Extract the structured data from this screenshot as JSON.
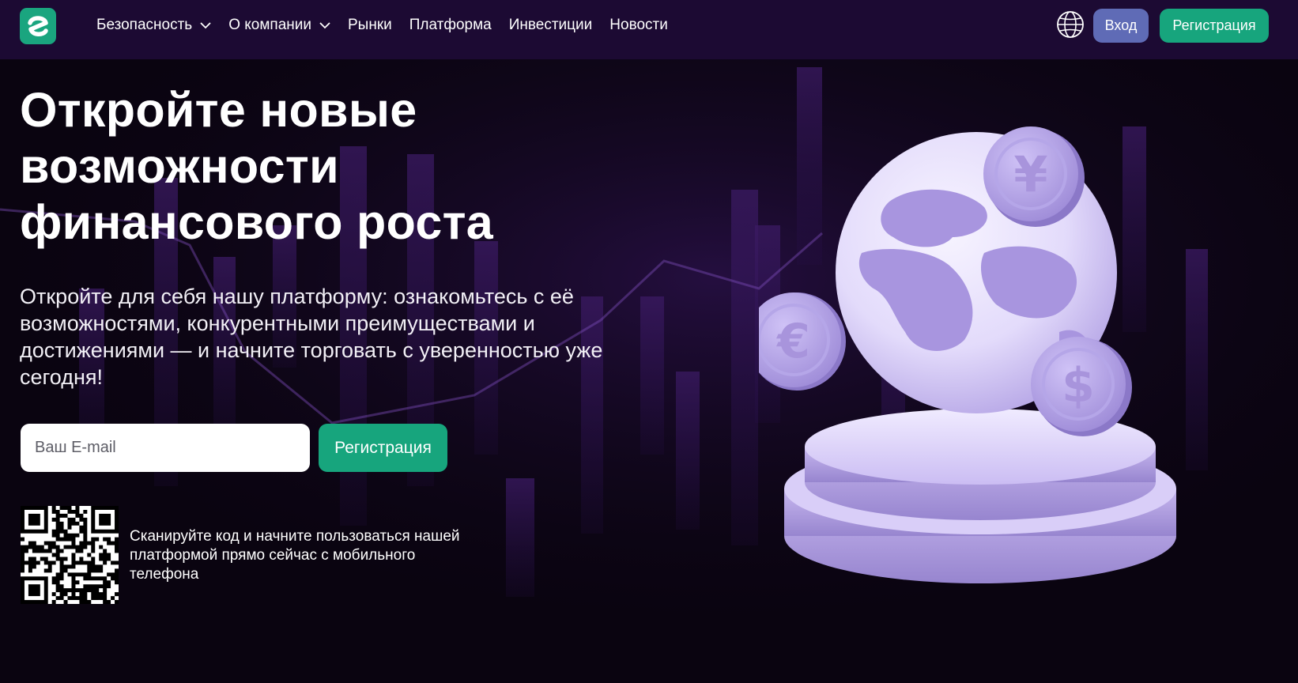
{
  "colors": {
    "nav_bg": "#1c0a33",
    "hero_bg": "#0a0410",
    "accent_green": "#17a57d",
    "login_blue": "#5f6bb6",
    "illustration_lilac": "#c6b8f2"
  },
  "header": {
    "logo_icon": "brand-logo-icon",
    "nav": [
      {
        "label": "Безопасность",
        "dropdown": true
      },
      {
        "label": "О компании",
        "dropdown": true
      },
      {
        "label": "Рынки",
        "dropdown": false
      },
      {
        "label": "Платформа",
        "dropdown": false
      },
      {
        "label": "Инвестиции",
        "dropdown": false
      },
      {
        "label": "Новости",
        "dropdown": false
      }
    ],
    "language_icon": "globe-icon",
    "login_label": "Вход",
    "register_label": "Регистрация"
  },
  "hero": {
    "title_lines": [
      "Откройте новые",
      "возможности",
      "финансового роста"
    ],
    "description": "Откройте для себя нашу платформу: ознакомьтесь с её возможностями, конкурентными преимуществами и достижениями — и начните торговать с уверенностью уже сегодня!",
    "email_placeholder": "Ваш E-mail",
    "email_value": "",
    "register_label": "Регистрация",
    "qr_icon": "qr-code-icon",
    "qr_caption": "Сканируйте код и начните пользоваться нашей платформой прямо сейчас с мобильного телефона"
  },
  "illustration": {
    "coin_symbols": [
      "¥",
      "€",
      "$"
    ]
  }
}
